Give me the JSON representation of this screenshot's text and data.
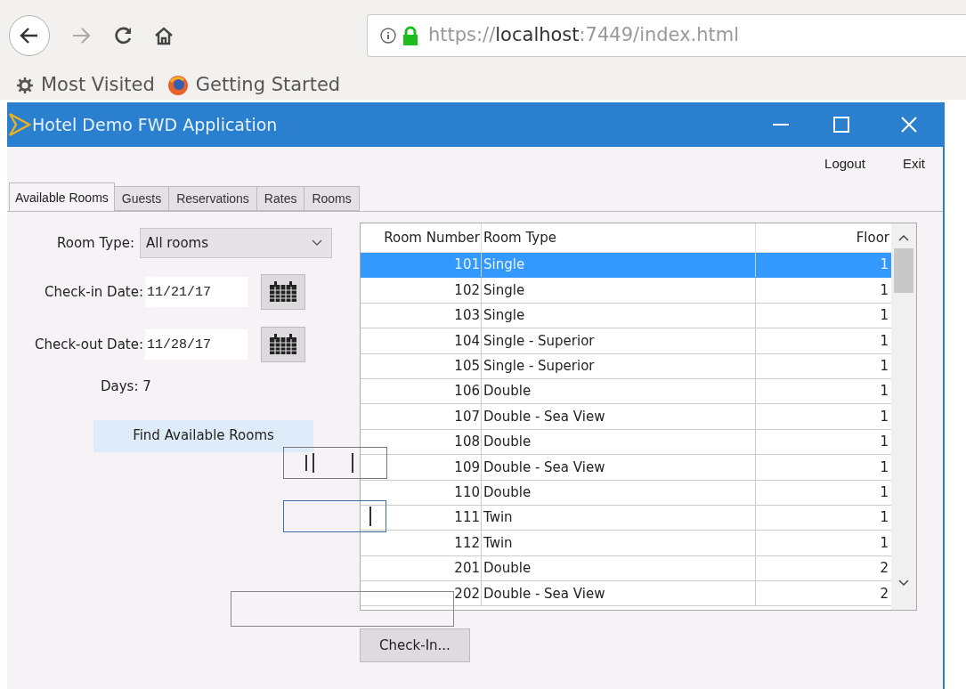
{
  "browser": {
    "url_scheme": "https://",
    "url_host": "localhost",
    "url_path": ":7449/index.html",
    "bookmarks": [
      {
        "kind": "gear",
        "label": "Most Visited"
      },
      {
        "kind": "globe",
        "label": "Getting Started"
      }
    ]
  },
  "window": {
    "title": "Hotel Demo FWD Application"
  },
  "menu": [
    "Logout",
    "Exit"
  ],
  "tabs": [
    {
      "label": "Available Rooms",
      "selected": true
    },
    {
      "label": "Guests",
      "selected": false
    },
    {
      "label": "Reservations",
      "selected": false
    },
    {
      "label": "Rates",
      "selected": false
    },
    {
      "label": "Rooms",
      "selected": false
    }
  ],
  "form": {
    "room_type_label": "Room Type:",
    "room_type_value": "All rooms",
    "checkin_label": "Check-in Date:",
    "checkin_value": "11/21/17",
    "checkout_label": "Check-out Date:",
    "checkout_value": "11/28/17",
    "days": "Days: 7",
    "find_button": "Find Available Rooms"
  },
  "table": {
    "columns": [
      "Room Number",
      "Room Type",
      "Floor"
    ],
    "rows": [
      {
        "number": "101",
        "type": "Single",
        "floor": "1",
        "selected": true
      },
      {
        "number": "102",
        "type": "Single",
        "floor": "1",
        "selected": false
      },
      {
        "number": "103",
        "type": "Single",
        "floor": "1",
        "selected": false
      },
      {
        "number": "104",
        "type": "Single - Superior",
        "floor": "1",
        "selected": false
      },
      {
        "number": "105",
        "type": "Single - Superior",
        "floor": "1",
        "selected": false
      },
      {
        "number": "106",
        "type": "Double",
        "floor": "1",
        "selected": false
      },
      {
        "number": "107",
        "type": "Double - Sea View",
        "floor": "1",
        "selected": false
      },
      {
        "number": "108",
        "type": "Double",
        "floor": "1",
        "selected": false
      },
      {
        "number": "109",
        "type": "Double - Sea View",
        "floor": "1",
        "selected": false
      },
      {
        "number": "110",
        "type": "Double",
        "floor": "1",
        "selected": false
      },
      {
        "number": "111",
        "type": "Twin",
        "floor": "1",
        "selected": false
      },
      {
        "number": "112",
        "type": "Twin",
        "floor": "1",
        "selected": false
      },
      {
        "number": "201",
        "type": "Double",
        "floor": "2",
        "selected": false
      },
      {
        "number": "202",
        "type": "Double - Sea View",
        "floor": "2",
        "selected": false
      }
    ]
  },
  "checkin_button": "Check-In..."
}
